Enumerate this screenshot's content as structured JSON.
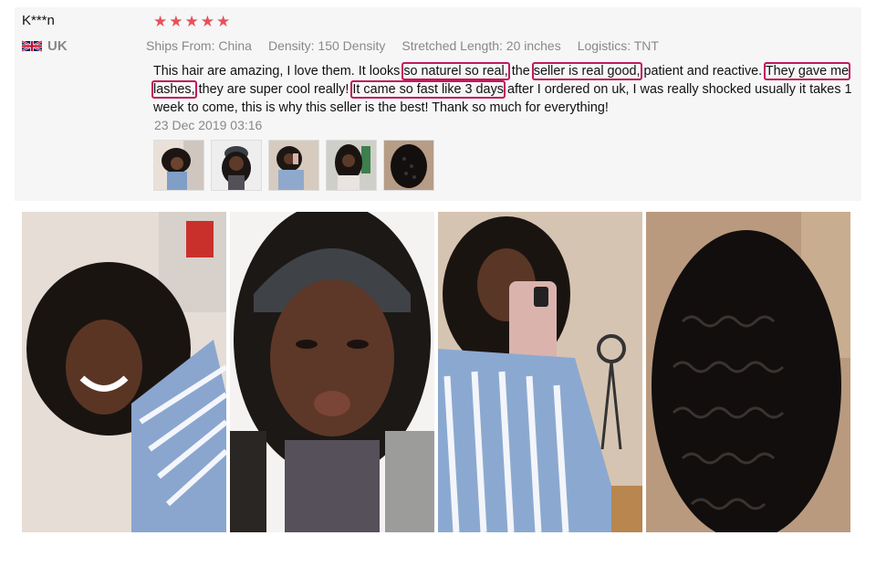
{
  "review": {
    "buyer_name": "K***n",
    "country": "UK",
    "rating": 5,
    "stars": [
      "★",
      "★",
      "★",
      "★",
      "★"
    ],
    "attributes": [
      {
        "key": "Ships From:",
        "value": "China"
      },
      {
        "key": "Density:",
        "value": "150 Density"
      },
      {
        "key": "Stretched Length:",
        "value": "20 inches"
      },
      {
        "key": "Logistics:",
        "value": "TNT"
      }
    ],
    "text_segments": [
      {
        "text": "This hair are amazing, I love them. It looks ",
        "highlight": false
      },
      {
        "text": "so naturel so real,",
        "highlight": true
      },
      {
        "text": " the ",
        "highlight": false
      },
      {
        "text": "seller is real good,",
        "highlight": true
      },
      {
        "text": " patient and reactive. ",
        "highlight": false
      },
      {
        "text": "They gave me lashes,",
        "highlight": true
      },
      {
        "text": " they are super cool really! ",
        "highlight": false
      },
      {
        "text": "It came so fast like 3 days",
        "highlight": true
      },
      {
        "text": " after I ordered on uk, I was really shocked usually it takes 1 week to come, this is why this seller is the best! Thank so much for everything!",
        "highlight": false
      }
    ],
    "date": "23 Dec 2019 03:16",
    "highlight_color": "#c2185b",
    "star_color": "#e8505b"
  }
}
